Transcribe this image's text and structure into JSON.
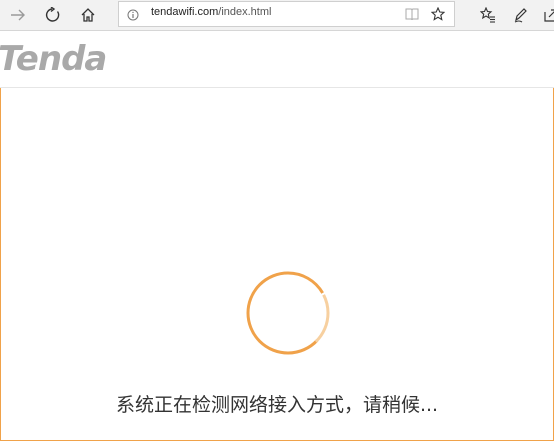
{
  "browser": {
    "url_host": "tendawifi.com",
    "url_path": "/index.html"
  },
  "page": {
    "logo_text": "Tenda",
    "status_message": "系统正在检测网络接入方式，请稍候..."
  },
  "icons": {
    "forward": "arrow-right-icon",
    "refresh": "refresh-icon",
    "home": "home-icon",
    "info": "info-icon",
    "reading_view": "book-icon",
    "favorite": "star-icon",
    "favorites_hub": "favorites-list-icon",
    "notes": "pen-icon",
    "share": "share-icon"
  },
  "colors": {
    "accent_orange": "#f0a24a",
    "logo_gray": "#a9a9a9"
  }
}
